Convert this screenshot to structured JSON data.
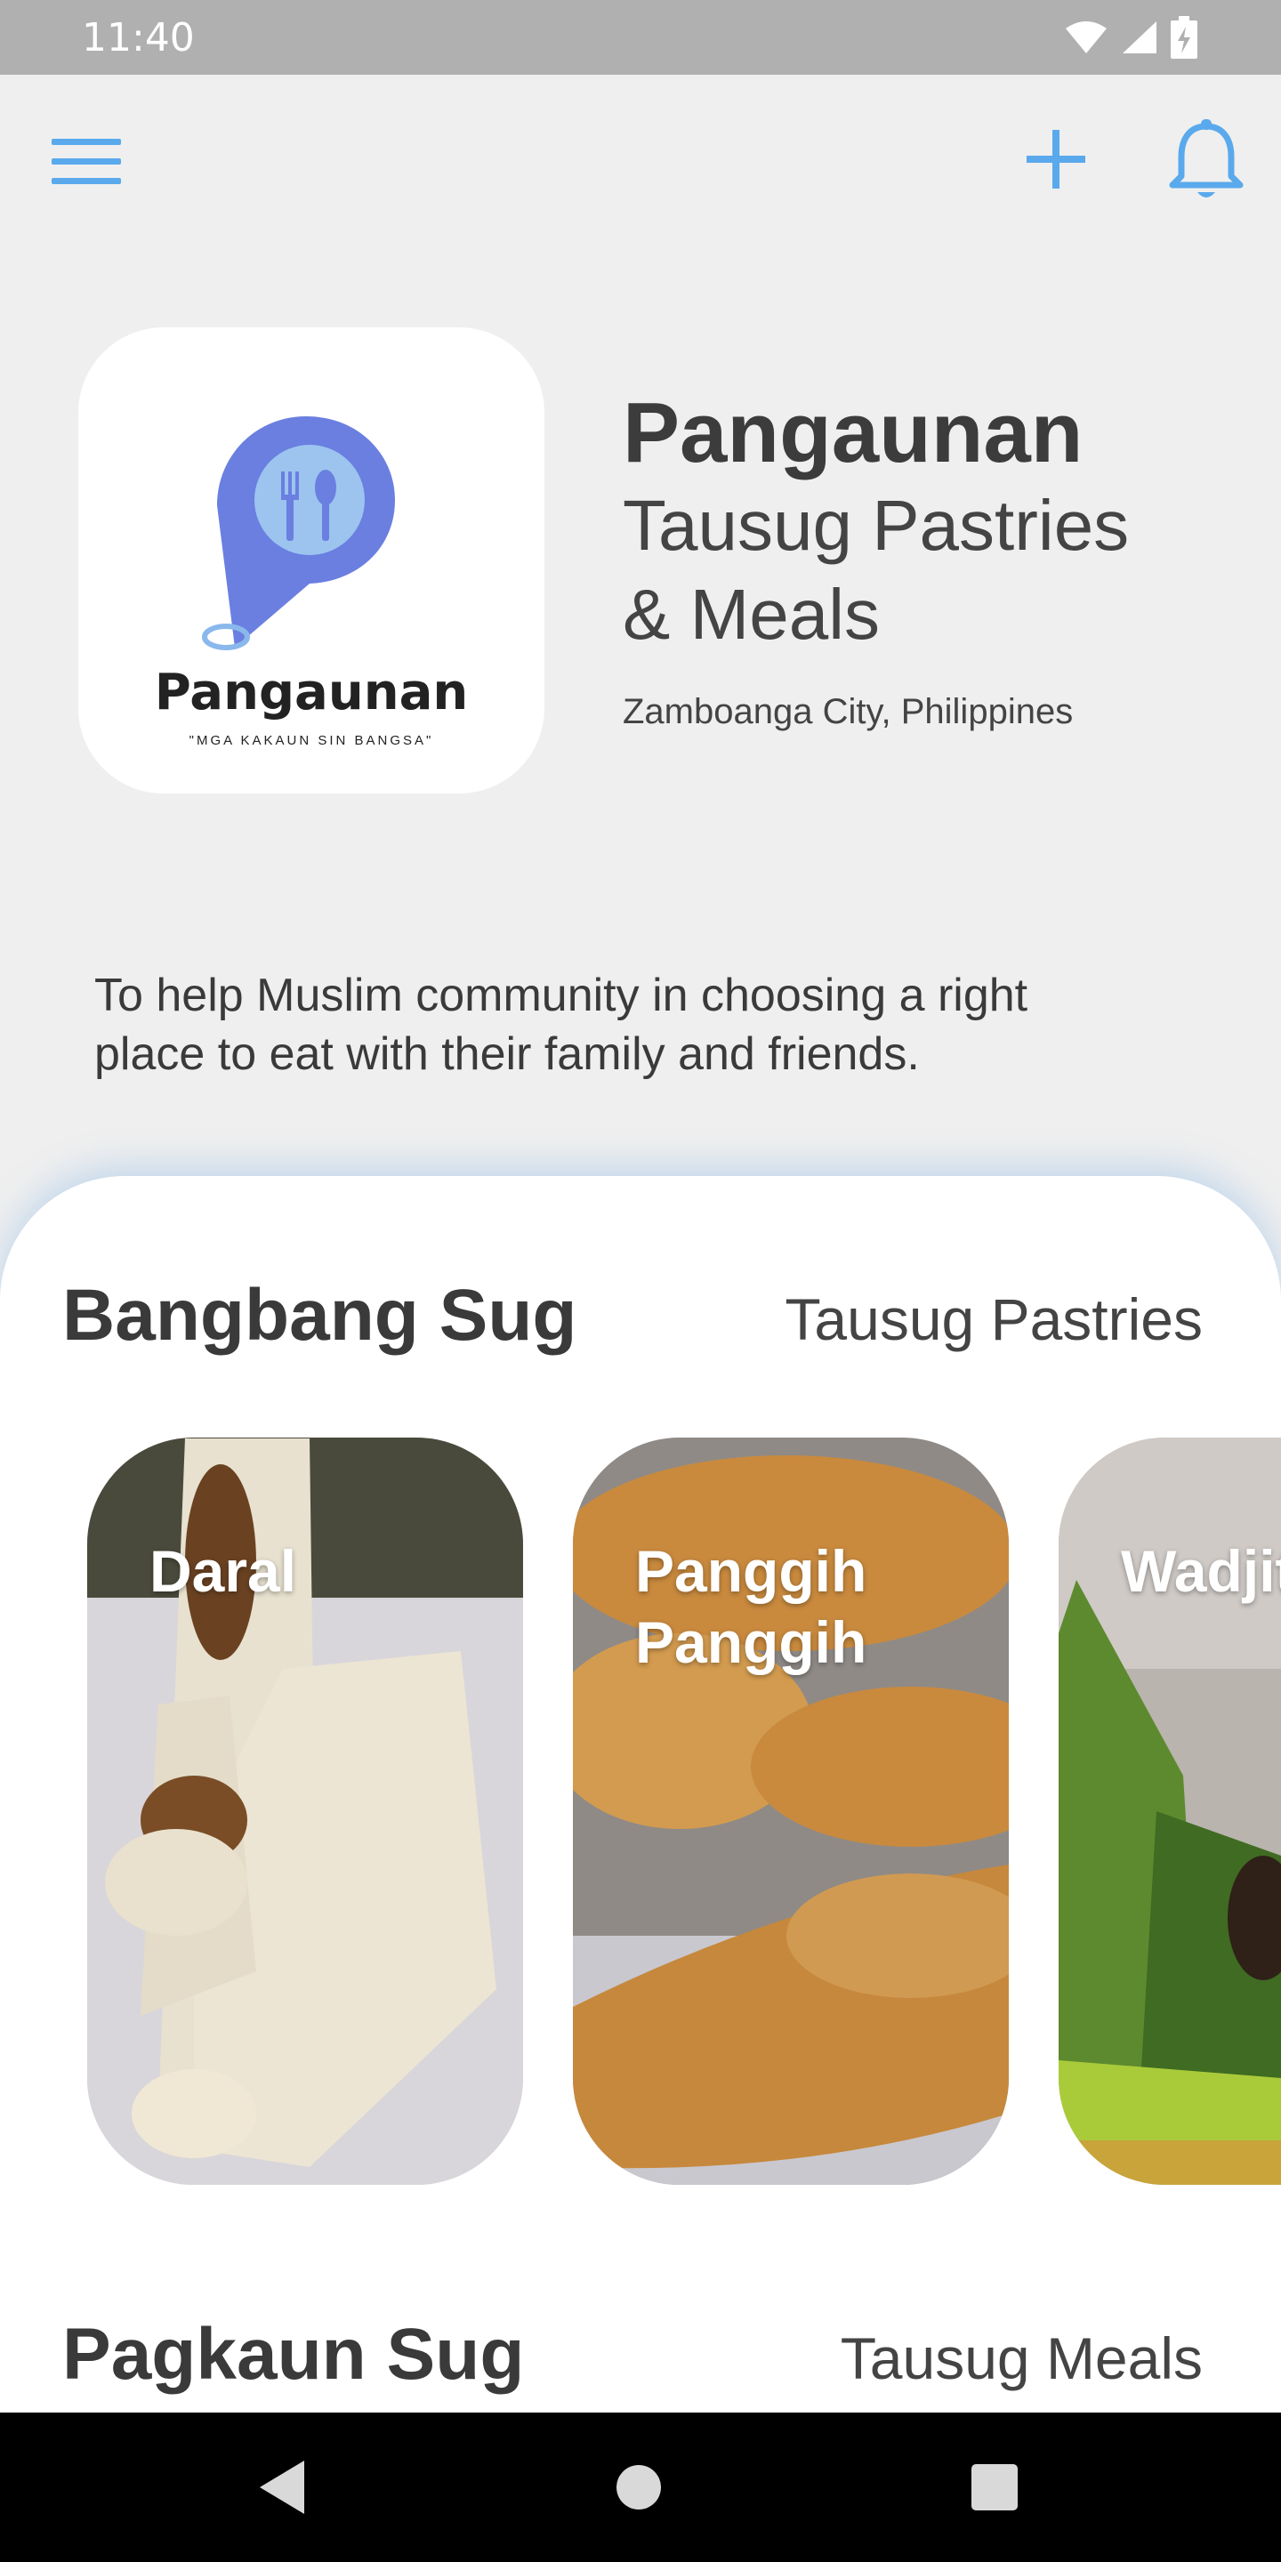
{
  "status_bar": {
    "time": "11:40",
    "icons": [
      "wifi-icon",
      "signal-icon",
      "battery-charging-icon"
    ]
  },
  "app_bar": {
    "icons": [
      "menu-icon",
      "plus-icon",
      "bell-icon"
    ],
    "accent": "#5aa9ec"
  },
  "logo": {
    "name": "Pangaunan",
    "tagline": "\"MGA KAKAUN SIN BANGSA\"",
    "pin_color": "#6a7fe0",
    "ring_color": "#8ab8ec"
  },
  "header": {
    "title": "Pangaunan",
    "subtitle_line1": "Tausug Pastries",
    "subtitle_line2": "& Meals",
    "location": "Zamboanga City, Philippines"
  },
  "mission": {
    "line1": "To help Muslim community in choosing a right",
    "line2": "place to eat with their family and friends."
  },
  "sections": [
    {
      "title": "Bangbang Sug",
      "subtitle": "Tausug Pastries",
      "items": [
        {
          "label_line1": "Daral",
          "label_line2": ""
        },
        {
          "label_line1": "Panggih",
          "label_line2": "Panggih"
        },
        {
          "label_line1": "Wadjit",
          "label_line2": ""
        }
      ]
    },
    {
      "title": "Pagkaun Sug",
      "subtitle": "Tausug Meals"
    }
  ],
  "nav_bar": {
    "icons": [
      "back-icon",
      "home-icon",
      "recents-icon"
    ]
  }
}
